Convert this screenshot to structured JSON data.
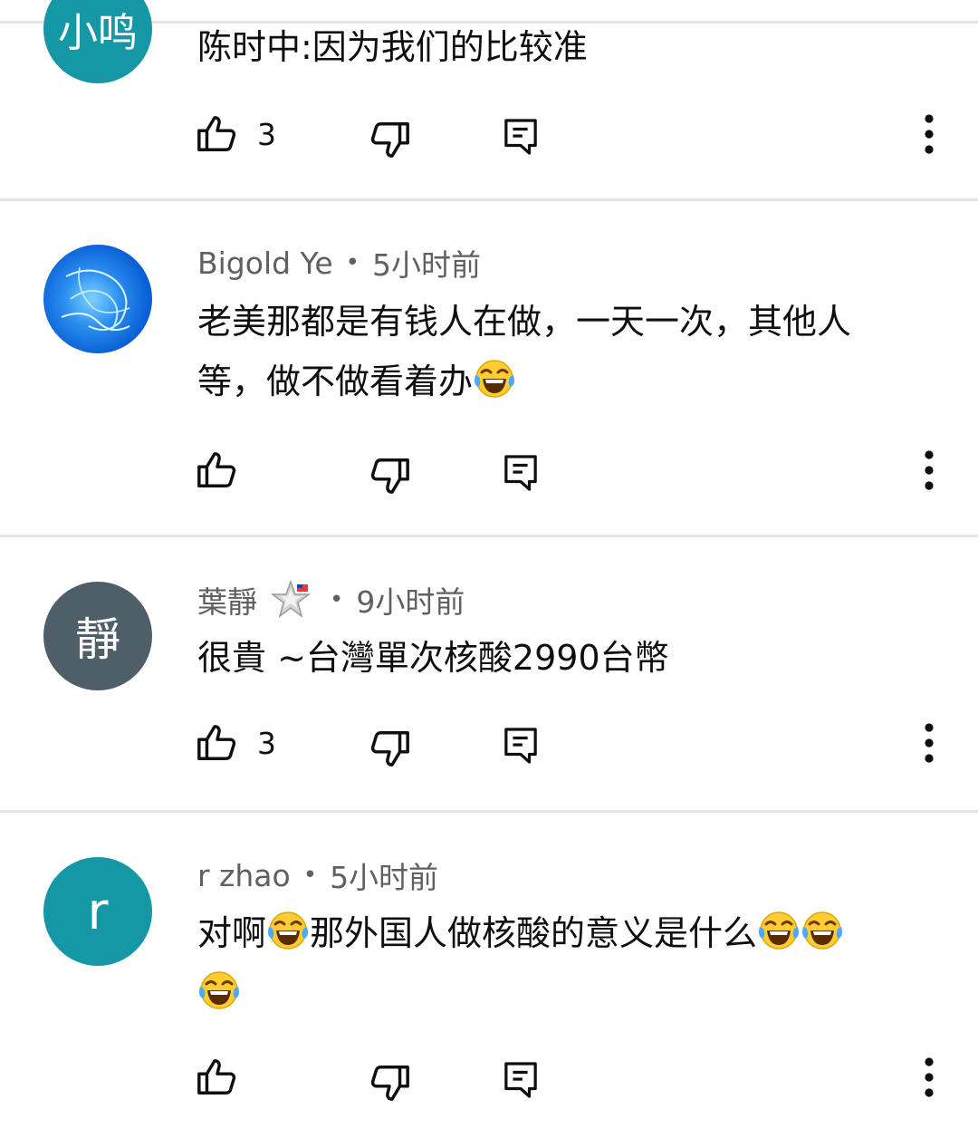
{
  "comments": [
    {
      "avatar_text": "小鸣",
      "author": "",
      "time": "",
      "text": "陈时中:因为我们的比较准",
      "likes": "3",
      "avatar_color": "#1597a6"
    },
    {
      "avatar_text": "",
      "author": "Bigold Ye",
      "time": "5小时前",
      "text_line1": "老美那都是有钱人在做，一天一次，其他人",
      "text_line2": "等，做不做看着办",
      "likes": "",
      "avatar_color": "#0a5fd6"
    },
    {
      "avatar_text": "靜",
      "author": "葉靜",
      "time": "9小时前",
      "text": "很貴 ~台灣單次核酸2990台幣",
      "likes": "3",
      "avatar_color": "#4f5f6a"
    },
    {
      "avatar_text": "r",
      "author": "r zhao",
      "time": "5小时前",
      "text_part1": "对啊",
      "text_part2": "那外国人做核酸的意义是什么",
      "likes": "",
      "avatar_color": "#1597a6"
    }
  ],
  "separator": "•",
  "icons": {
    "like": "thumb-up-icon",
    "dislike": "thumb-down-icon",
    "reply": "reply-icon",
    "more": "more-vert-icon",
    "emoji": "face-with-tears-of-joy-emoji",
    "badge": "star-badge-icon"
  }
}
